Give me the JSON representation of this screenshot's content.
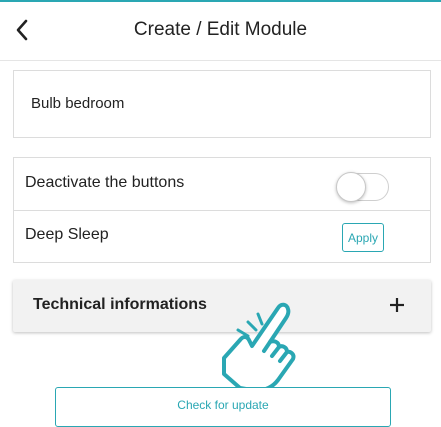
{
  "header": {
    "title": "Create / Edit Module",
    "back_icon": "chevron-left-icon"
  },
  "module": {
    "name": "Bulb bedroom"
  },
  "settings": {
    "deactivate_label": "Deactivate the buttons",
    "deactivate_on": false,
    "deep_sleep_label": "Deep Sleep",
    "apply_label": "Apply"
  },
  "technical": {
    "label": "Technical informations",
    "expand_icon": "plus-icon"
  },
  "gesture": {
    "icon": "tap-hand-icon"
  },
  "update": {
    "label": "Check for update"
  },
  "colors": {
    "accent": "#2aa7b3",
    "panel_bg": "#f2f2f2",
    "border": "#dcdcdc"
  }
}
